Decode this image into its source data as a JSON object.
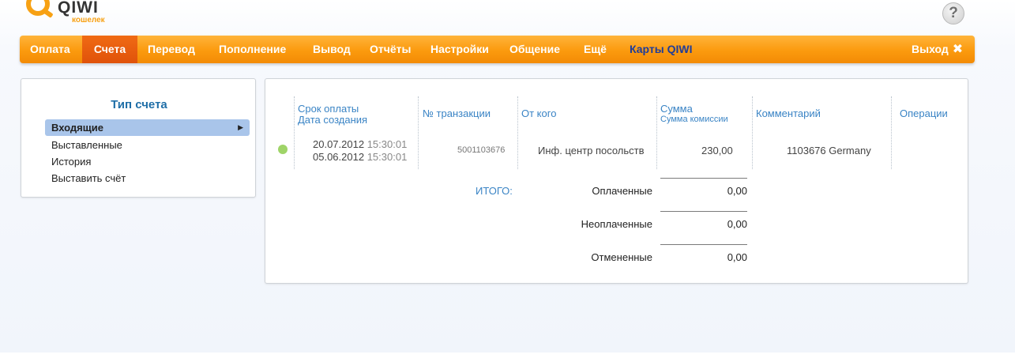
{
  "logo": {
    "brand": "QIWI",
    "sub": "кошелек"
  },
  "help": {
    "label": "?"
  },
  "nav": {
    "items": [
      "Оплата",
      "Счета",
      "Перевод",
      "Пополнение",
      "Вывод",
      "Отчёты",
      "Настройки",
      "Общение",
      "Ещё"
    ],
    "cards": "Карты QIWI",
    "exit": "Выход",
    "exit_icon": "✖",
    "active": "Счета"
  },
  "sidebar": {
    "title": "Тип счета",
    "items": [
      {
        "label": "Входящие",
        "selected": true
      },
      {
        "label": "Выставленные"
      },
      {
        "label": "История"
      },
      {
        "label": "Выставить счёт"
      }
    ],
    "arrow": "▶"
  },
  "table": {
    "headers": {
      "due_date": "Срок оплаты",
      "created": "Дата создания",
      "txn": "№ транзакции",
      "from": "От кого",
      "amount": "Сумма",
      "commission": "Сумма комиссии",
      "comment": "Комментарий",
      "ops": "Операции"
    },
    "rows": [
      {
        "status_color": "#9fd468",
        "due_date": "20.07.2012",
        "due_time": "15:30:01",
        "created_date": "05.06.2012",
        "created_time": "15:30:01",
        "txn": "5001103676",
        "from": "Инф. центр посольств",
        "amount": "230,00",
        "comment": "1103676 Germany"
      }
    ]
  },
  "totals": {
    "label": "ИТОГО:",
    "lines": [
      {
        "label": "Оплаченные",
        "value": "0,00"
      },
      {
        "label": "Неоплаченные",
        "value": "0,00"
      },
      {
        "label": "Отмененные",
        "value": "0,00"
      }
    ]
  },
  "colors": {
    "nav_orange": "#fb9a0e",
    "nav_active": "#e0520a",
    "link_blue": "#3a84c5",
    "selected_bg": "#a9c5ea"
  }
}
